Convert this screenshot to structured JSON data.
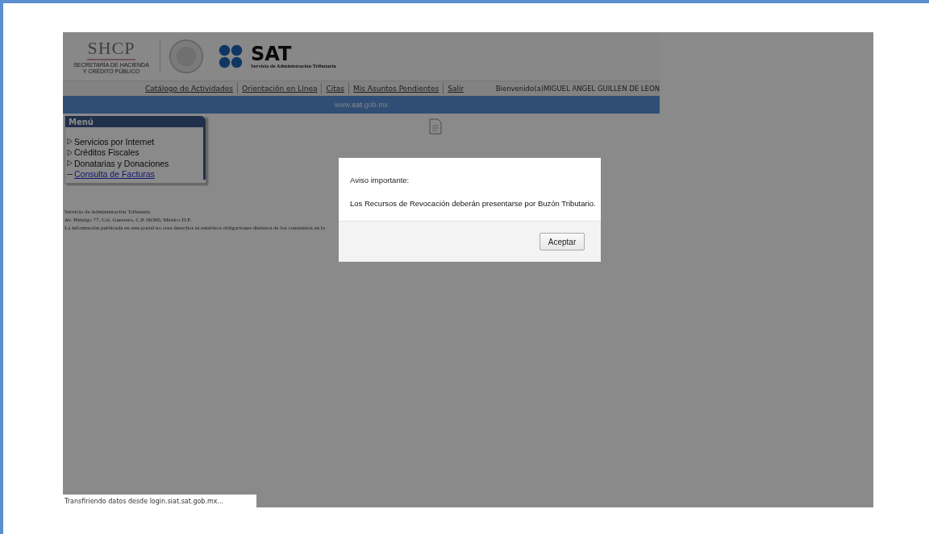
{
  "header": {
    "shcp": {
      "title": "SHCP",
      "subtitle": [
        "SECRETARÍA DE HACIENDA",
        "Y CRÉDITO PÚBLICO"
      ]
    },
    "sat": {
      "title": "SAT",
      "subtitle": "Servicio de Administración Tributaria"
    }
  },
  "nav": {
    "links": [
      "Catálogo de Actividades",
      "Orientación en Línea",
      "Citas",
      "Mis Asuntos Pendientes",
      "Salir"
    ],
    "welcome": "Bienvenido(a)MIGUEL ANGEL GUILLEN DE LEON"
  },
  "banner": {
    "prefix": "www.",
    "bold": "sat",
    "suffix": ".gob.mx"
  },
  "menu": {
    "title": "Menú",
    "items": [
      {
        "label": "Servicios por Internet",
        "kind": "expandable"
      },
      {
        "label": "Créditos Fiscales",
        "kind": "expandable"
      },
      {
        "label": "Donatarias y Donaciones",
        "kind": "expandable"
      },
      {
        "label": "Consulta de Facturas",
        "kind": "link"
      }
    ]
  },
  "footer": [
    "Servicio de Administración Tributaria",
    "Av. Hidalgo 77, Col. Guerrero, C.P. 06300, México D.F.",
    "La información publicada en este portal no crea derechos ni establece obligaciones distintos de los contenidos en la"
  ],
  "dialog": {
    "title": "Aviso importante:",
    "message": "Los Recursos de Revocación deberán presentarse por Buzón Tributario.",
    "button": "Aceptar"
  },
  "status_bar": "Transfiriendo datos desde login.siat.sat.gob.mx..."
}
